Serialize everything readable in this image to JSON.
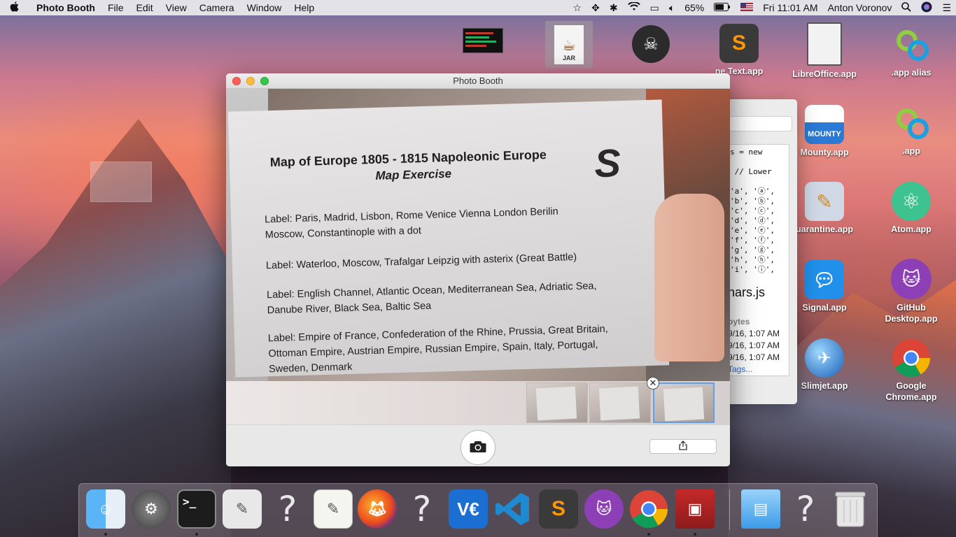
{
  "menubar": {
    "app_name": "Photo Booth",
    "menus": [
      "File",
      "Edit",
      "View",
      "Camera",
      "Window",
      "Help"
    ],
    "battery": "65%",
    "clock": "Fri 11:01 AM",
    "user": "Anton Voronov"
  },
  "desktop_icons": {
    "jar": {
      "badge": "JAR"
    },
    "sublime_label": "ne Text.app",
    "libreoffice_label": "LibreOffice.app",
    "app_alias_label": ".app alias",
    "mounty_label": "Mounty.app",
    "mounty_badge": "MOUNTY",
    "app_label": ".app",
    "quarantine_label": "uarantine.app",
    "atom_label": "Atom.app",
    "signal_label": "Signal.app",
    "github_label": "GitHub Desktop.app",
    "slimjet_label": "Slimjet.app",
    "chrome_label": "Google Chrome.app"
  },
  "finder": {
    "code_lines": [
      "s = new",
      "",
      " // Lower",
      "",
      "'a', 'ⓐ',",
      "'b', 'ⓑ',",
      "'c', 'ⓒ',",
      "'d', 'ⓓ',",
      "'e', 'ⓔ',",
      "'f', 'ⓕ',",
      "'g', 'ⓖ',",
      "'h', 'ⓗ',",
      "'i', 'ⓘ',"
    ],
    "filename": "hars.js",
    "size": "bytes",
    "date1": "9/16, 1:07 AM",
    "date2": "9/16, 1:07 AM",
    "date3": "9/16, 1:07 AM",
    "tags": "Tags..."
  },
  "photobooth": {
    "title": "Photo Booth",
    "paper": {
      "title": "Map of Europe 1805 - 1815 Napoleonic Europe",
      "subtitle": "Map Exercise",
      "logo_letter": "S",
      "line1": "Label: Paris, Madrid, Lisbon, Rome Venice Vienna London Berilin",
      "line2": "Moscow, Constantinople with a dot",
      "line3": "Label: Waterloo, Moscow, Trafalgar Leipzig with asterix (Great Battle)",
      "line4": "Label: English Channel, Atlantic Ocean, Mediterranean Sea, Adriatic Sea,",
      "line5": "Danube River, Black Sea, Baltic Sea",
      "line6": "Label: Empire of France, Confederation of the Rhine, Prussia, Great Britain,",
      "line7": "Ottoman Empire, Austrian Empire, Russian Empire, Spain, Italy, Portugal,",
      "line8": "Sweden, Denmark"
    },
    "delete_glyph": "✕"
  },
  "dock": {
    "vnc_label": "V€",
    "question_mark": "?"
  },
  "colors": {
    "close": "#fc605c",
    "minimize": "#fdbc40",
    "zoom": "#34c84a",
    "selection": "#5ea0f0"
  }
}
